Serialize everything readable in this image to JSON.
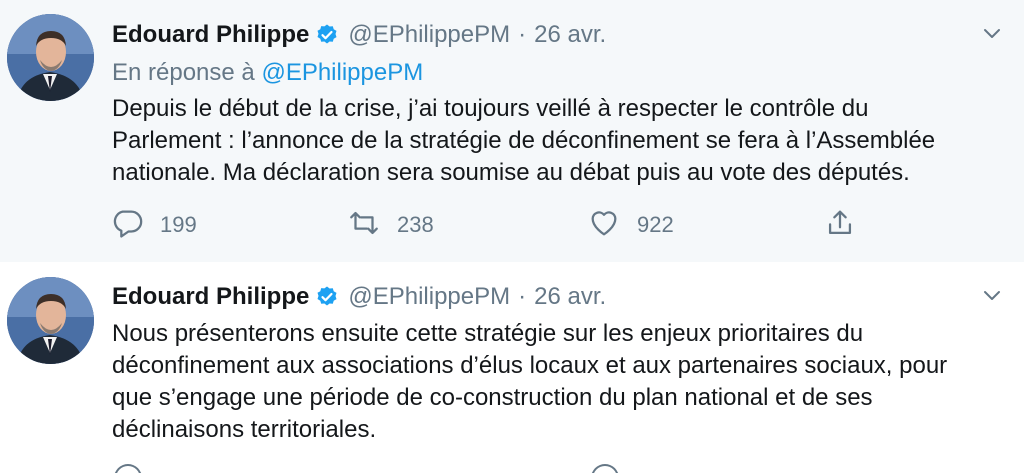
{
  "tweets": [
    {
      "name": "Edouard Philippe",
      "handle": "@EPhilippePM",
      "separator": "·",
      "date": "26 avr.",
      "reply_prefix": "En réponse à",
      "reply_mention": "@EPhilippePM",
      "text_lines": [
        "Depuis le début de la crise, j’ai toujours veillé à respecter le contrôle du",
        "Parlement : l’annonce de la stratégie de déconfinement se fera à l’Assemblée",
        "nationale. Ma déclaration sera soumise au débat puis au vote des députés."
      ],
      "replies": "199",
      "retweets": "238",
      "likes": "922"
    },
    {
      "name": "Edouard Philippe",
      "handle": "@EPhilippePM",
      "separator": "·",
      "date": "26 avr.",
      "text_lines": [
        "Nous présenterons ensuite cette stratégie sur les enjeux prioritaires du",
        "déconfinement aux associations d’élus locaux et aux partenaires sociaux, pour",
        "que s’engage une période de co-construction du plan national et de ses",
        "déclinaisons territoriales."
      ]
    }
  ],
  "icons": {
    "verified": "verified-badge-icon",
    "caret": "chevron-down-icon",
    "reply": "reply-icon",
    "retweet": "retweet-icon",
    "like": "heart-icon",
    "share": "share-icon"
  },
  "colors": {
    "accent": "#1da1f2",
    "link": "#1b95e0",
    "secondary_text": "#657786",
    "thread_line": "#ccd6dd",
    "highlight_bg": "#f5f8fa"
  }
}
